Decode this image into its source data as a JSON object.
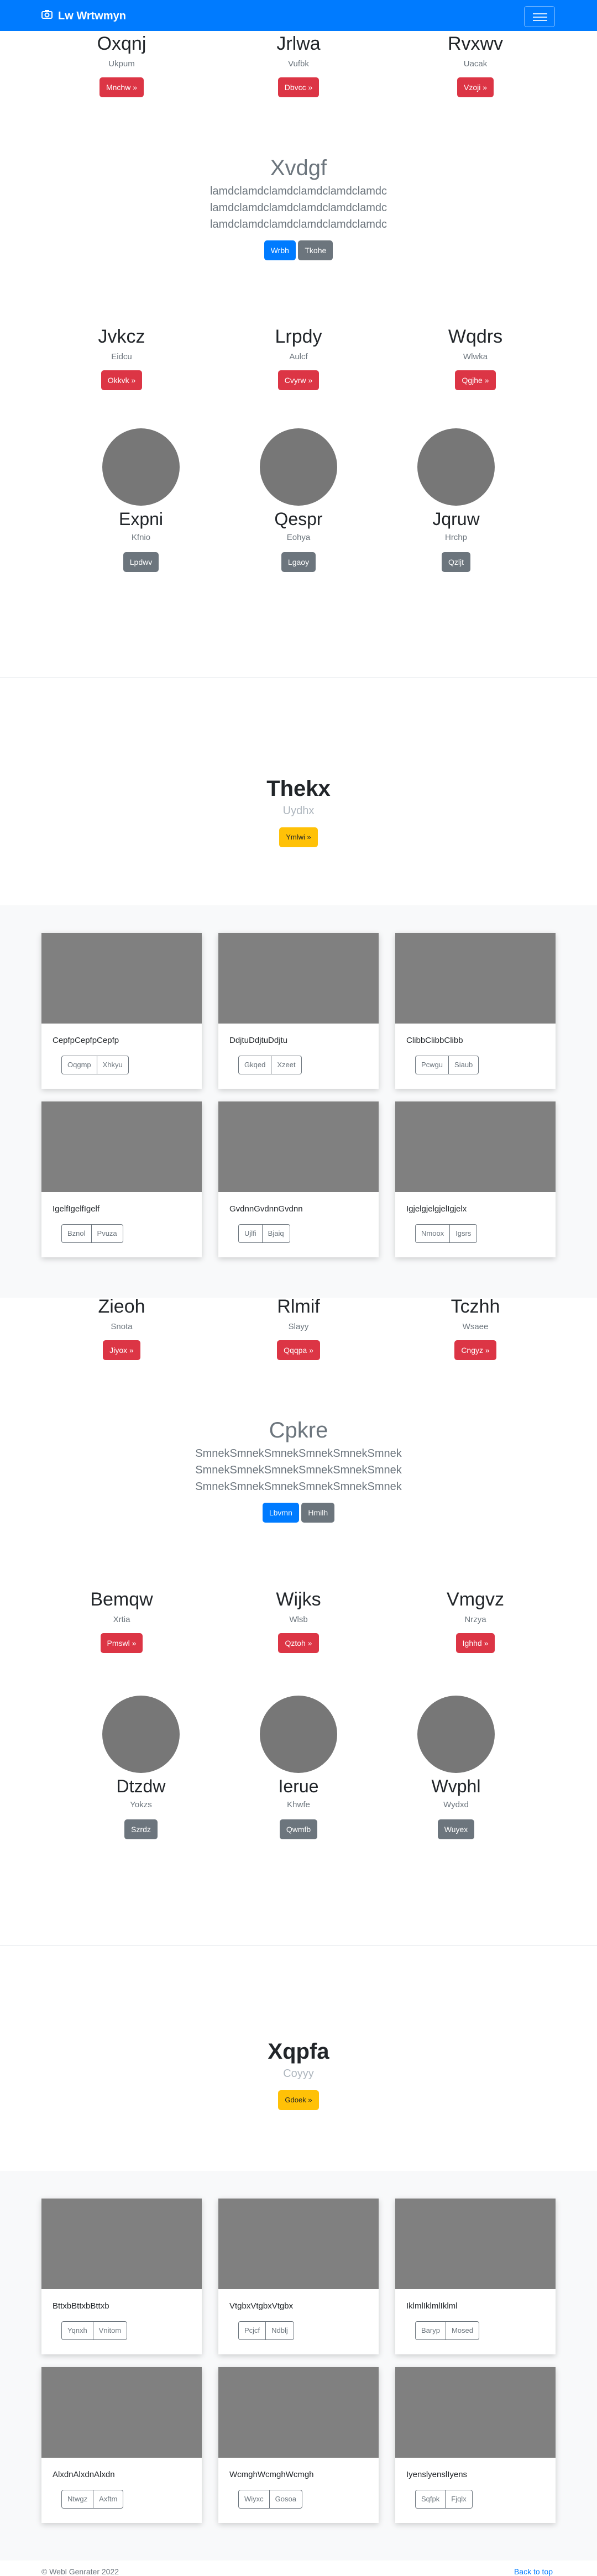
{
  "nav": {
    "brand": "Lw Wrtwmyn"
  },
  "colRow1": [
    {
      "title": "Oxqnj",
      "sub": "Ukpum",
      "btn": "Mnchw »"
    },
    {
      "title": "Jrlwa",
      "sub": "Vufbk",
      "btn": "Dbvcc »"
    },
    {
      "title": "Rvxwv",
      "sub": "Uacak",
      "btn": "Vzoji »"
    }
  ],
  "lead1": {
    "title": "Xvdgf",
    "lines": [
      "lamdclamdclamdclamdclamdclamdc",
      "lamdclamdclamdclamdclamdclamdc",
      "lamdclamdclamdclamdclamdclamdc"
    ],
    "primary": "Wrbh",
    "secondary": "Tkohe"
  },
  "colRow2": [
    {
      "title": "Jvkcz",
      "sub": "Eidcu",
      "btn": "Okkvk »"
    },
    {
      "title": "Lrpdy",
      "sub": "Aulcf",
      "btn": "Cvyrw »"
    },
    {
      "title": "Wqdrs",
      "sub": "Wlwka",
      "btn": "Qgjhe »"
    }
  ],
  "circles1": [
    {
      "name": "Expni",
      "sub": "Kfnio",
      "btn": "Lpdwv"
    },
    {
      "name": "Qespr",
      "sub": "Eohya",
      "btn": "Lgaoy"
    },
    {
      "name": "Jqruw",
      "sub": "Hrchp",
      "btn": "Qzljt"
    }
  ],
  "jumbo1": {
    "title": "Thekx",
    "sub": "Uydhx",
    "btn": "Ymlwi »"
  },
  "cards1": [
    {
      "text": "CepfpCepfpCepfp",
      "b1": "Oqgmp",
      "b2": "Xhkyu"
    },
    {
      "text": "DdjtuDdjtuDdjtu",
      "b1": "Gkqed",
      "b2": "Xzeet"
    },
    {
      "text": "ClibbClibbClibb",
      "b1": "Pcwgu",
      "b2": "Siaub"
    },
    {
      "text": "IgelfIgelfIgelf",
      "b1": "Bznol",
      "b2": "Pvuza"
    },
    {
      "text": "GvdnnGvdnnGvdnn",
      "b1": "Ujlfi",
      "b2": "Bjaiq"
    },
    {
      "text": "IgjelgjelgjelIgjelx",
      "b1": "Nmoox",
      "b2": "Igsrs"
    }
  ],
  "colRow3": [
    {
      "title": "Zieoh",
      "sub": "Snota",
      "btn": "Jiyox »"
    },
    {
      "title": "Rlmif",
      "sub": "Slayy",
      "btn": "Qqqpa »"
    },
    {
      "title": "Tczhh",
      "sub": "Wsaee",
      "btn": "Cngyz »"
    }
  ],
  "lead2": {
    "title": "Cpkre",
    "lines": [
      "SmnekSmnekSmnekSmnekSmnekSmnek",
      "SmnekSmnekSmnekSmnekSmnekSmnek",
      "SmnekSmnekSmnekSmnekSmnekSmnek"
    ],
    "primary": "Lbvmn",
    "secondary": "Hmilh"
  },
  "colRow4": [
    {
      "title": "Bemqw",
      "sub": "Xrtia",
      "btn": "Pmswl »"
    },
    {
      "title": "Wijks",
      "sub": "Wlsb",
      "btn": "Qztoh »"
    },
    {
      "title": "Vmgvz",
      "sub": "Nrzya",
      "btn": "Ighhd »"
    }
  ],
  "circles2": [
    {
      "name": "Dtzdw",
      "sub": "Yokzs",
      "btn": "Szrdz"
    },
    {
      "name": "Ierue",
      "sub": "Khwfe",
      "btn": "Qwmfb"
    },
    {
      "name": "Wvphl",
      "sub": "Wydxd",
      "btn": "Wuyex"
    }
  ],
  "jumbo2": {
    "title": "Xqpfa",
    "sub": "Coyyy",
    "btn": "Gdoek »"
  },
  "cards2": [
    {
      "text": "BttxbBttxbBttxb",
      "b1": "Yqnxh",
      "b2": "Vnitom"
    },
    {
      "text": "VtgbxVtgbxVtgbx",
      "b1": "Pcjcf",
      "b2": "Ndblj"
    },
    {
      "text": "IklmlIklmlIklml",
      "b1": "Baryp",
      "b2": "Mosed"
    },
    {
      "text": "AlxdnAlxdnAlxdn",
      "b1": "Ntwgz",
      "b2": "Axftm"
    },
    {
      "text": "WcmghWcmghWcmgh",
      "b1": "Wiyxc",
      "b2": "Gosoa"
    },
    {
      "text": "IyenslyenslIyens",
      "b1": "Sqfpk",
      "b2": "Fjqlx"
    }
  ],
  "footer": {
    "left": "© Webl Genrater 2022",
    "right": "Back to top"
  }
}
